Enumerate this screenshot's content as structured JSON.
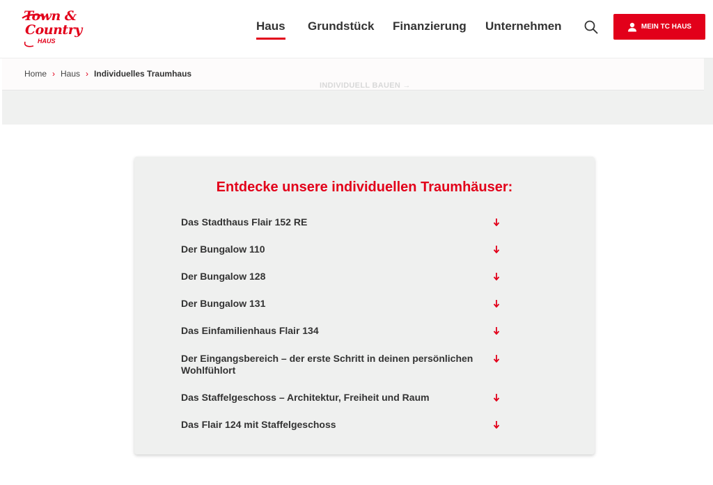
{
  "brand": {
    "logo_line1": "Town &",
    "logo_line2": "Country",
    "logo_line3": "HAUS",
    "color": "#e2001a"
  },
  "nav": {
    "items": [
      {
        "label": "Haus",
        "active": true
      },
      {
        "label": "Grundstück",
        "active": false
      },
      {
        "label": "Finanzierung",
        "active": false
      },
      {
        "label": "Unternehmen",
        "active": false
      }
    ],
    "search_icon": "search-icon",
    "cta_label": "MEIN TC HAUS",
    "cta_icon": "user-icon"
  },
  "breadcrumb": {
    "items": [
      "Home",
      "Haus",
      "Individuelles Traumhaus"
    ],
    "separator_icon": "chevron-right-icon"
  },
  "ghost_link": "INDIVIDUELL BAUEN →",
  "card": {
    "title": "Entdecke unsere individuellen Traumhäuser:",
    "items": [
      "Das Stadthaus Flair 152 RE",
      "Der Bungalow 110",
      "Der Bungalow 128",
      "Der Bungalow 131",
      "Das Einfamilienhaus Flair 134",
      "Der Eingangsbereich – der erste Schritt in deinen persönlichen Wohlfühlort",
      "Das Staffelgeschoss – Architektur, Freiheit und Raum",
      "Das Flair 124 mit Staffelgeschoss"
    ],
    "item_icon": "arrow-down-icon"
  }
}
